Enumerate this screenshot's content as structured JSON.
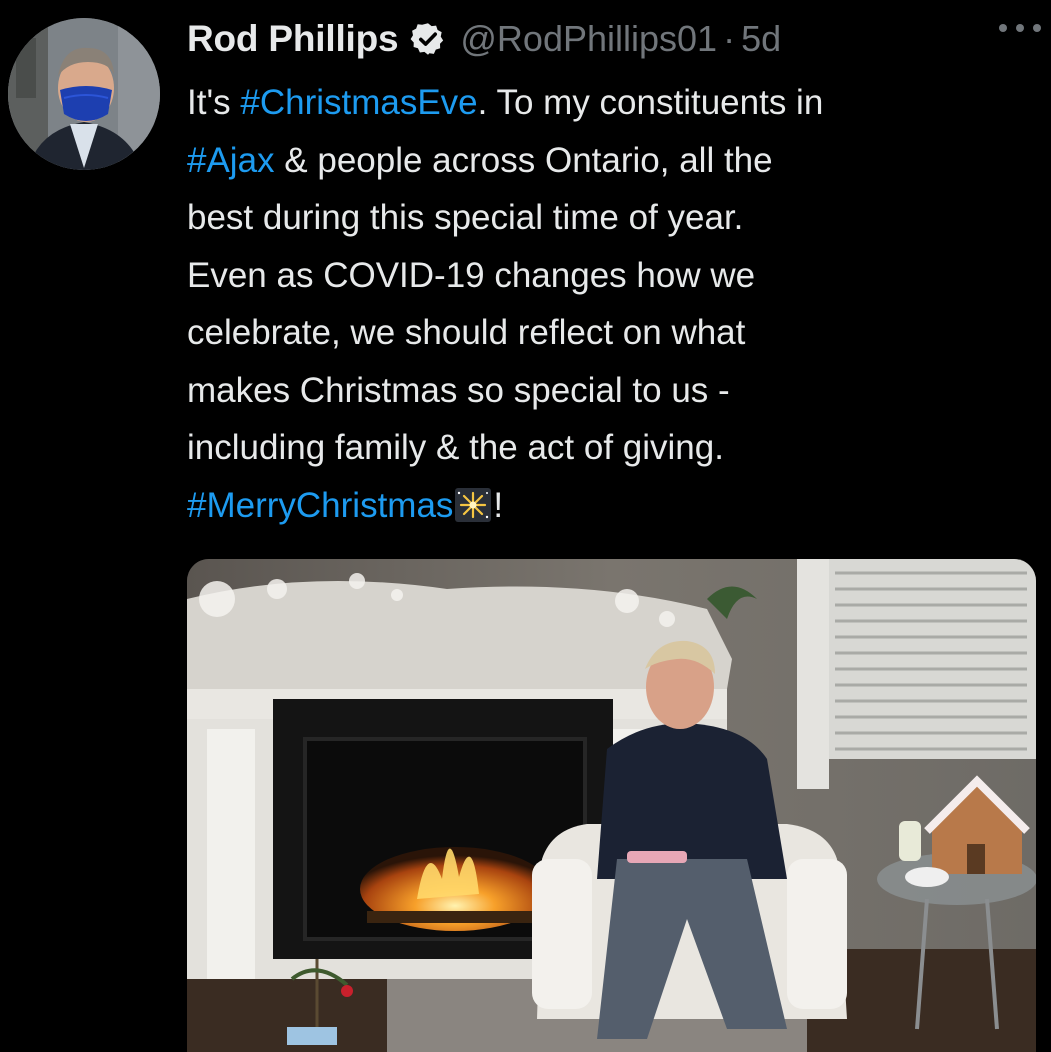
{
  "tweet": {
    "author": {
      "display_name": "Rod Phillips",
      "handle": "@RodPhillips01",
      "verified": true,
      "avatar_icon": "profile-photo"
    },
    "separator": "·",
    "timestamp": "5d",
    "more_icon": "more-horizontal-icon",
    "text": {
      "p1": "It's ",
      "tag_christmas_eve": "#ChristmasEve",
      "p2": ". To my constituents in\n",
      "tag_ajax": "#Ajax",
      "p3": " & people across Ontario, all the\nbest during this special time of year.\nEven as COVID-19 changes how we\ncelebrate, we should reflect on what\nmakes Christmas so special to us -\nincluding family & the act of giving.\n",
      "tag_merry_christmas": "#MerryChristmas",
      "emoji": "sparkles",
      "p4": "!"
    },
    "media": {
      "type": "image",
      "subject": "man-seated-by-fireplace"
    }
  },
  "colors": {
    "background": "#000000",
    "text": "#e7e9ea",
    "secondary": "#71767b",
    "link": "#1d9bf0"
  }
}
